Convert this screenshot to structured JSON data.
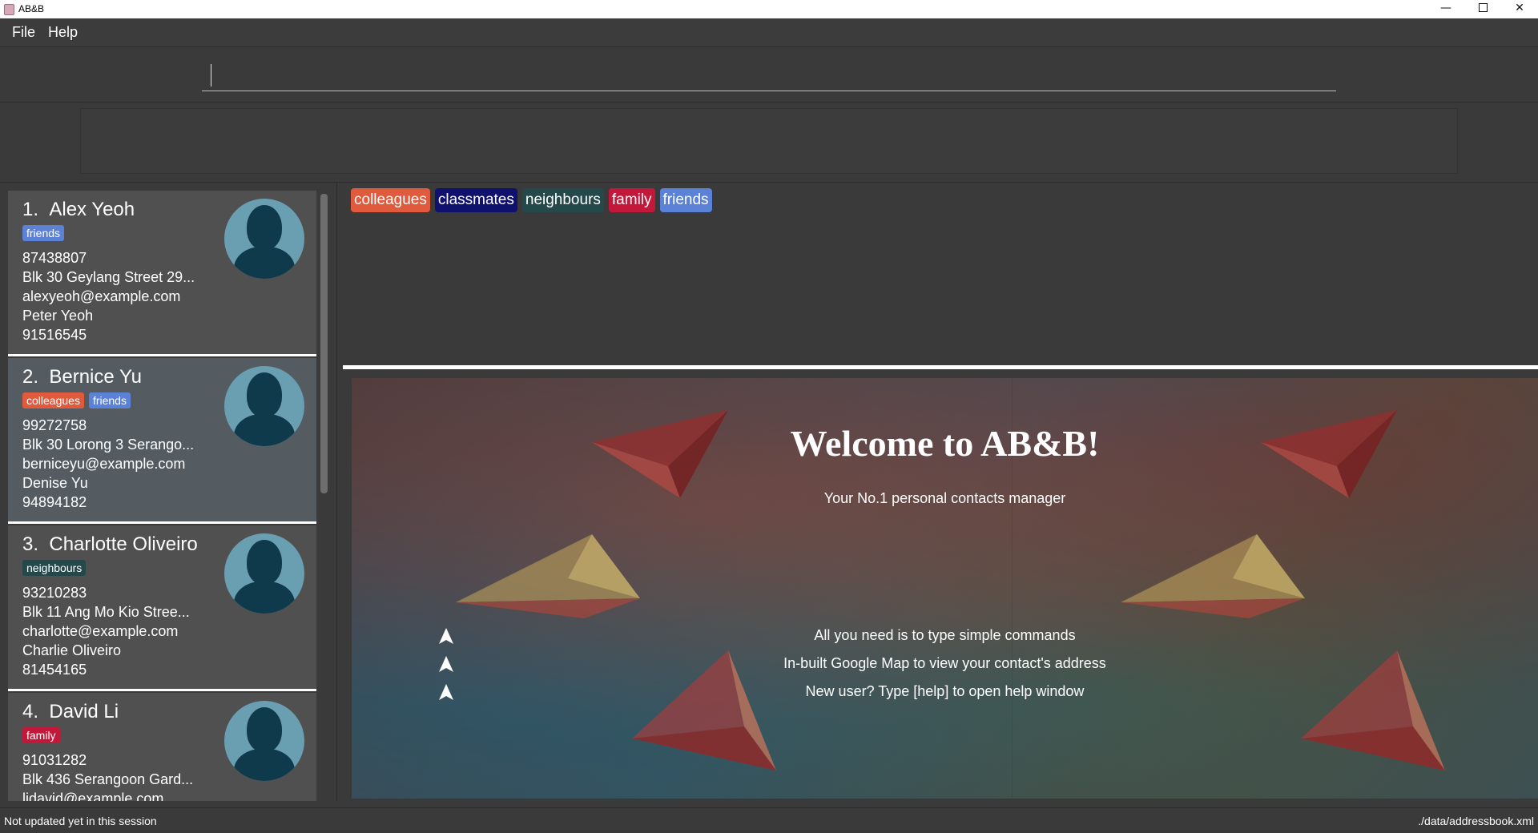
{
  "window": {
    "title": "AB&B",
    "min_glyph": "—",
    "close_glyph": "✕"
  },
  "menu": {
    "file": "File",
    "help": "Help"
  },
  "command": {
    "value": "",
    "placeholder": ""
  },
  "persons": [
    {
      "index": "1.",
      "name": "Alex Yeoh",
      "tags": [
        {
          "label": "friends",
          "color": "#5b82d6"
        }
      ],
      "phone": "87438807",
      "address": "Blk 30 Geylang Street 29...",
      "email": "alexyeoh@example.com",
      "contact_name": "Peter Yeoh",
      "contact_phone": "91516545"
    },
    {
      "index": "2.",
      "name": "Bernice Yu",
      "tags": [
        {
          "label": "colleagues",
          "color": "#e05a3d"
        },
        {
          "label": "friends",
          "color": "#5b82d6"
        }
      ],
      "phone": "99272758",
      "address": "Blk 30 Lorong 3 Serango...",
      "email": "berniceyu@example.com",
      "contact_name": "Denise Yu",
      "contact_phone": "94894182"
    },
    {
      "index": "3.",
      "name": "Charlotte Oliveiro",
      "tags": [
        {
          "label": "neighbours",
          "color": "#25484b"
        }
      ],
      "phone": "93210283",
      "address": "Blk 11 Ang Mo Kio Stree...",
      "email": "charlotte@example.com",
      "contact_name": "Charlie Oliveiro",
      "contact_phone": "81454165"
    },
    {
      "index": "4.",
      "name": "David Li",
      "tags": [
        {
          "label": "family",
          "color": "#c4183a"
        }
      ],
      "phone": "91031282",
      "address": "Blk 436 Serangoon Gard...",
      "email": "lidavid@example.com",
      "contact_name": "",
      "contact_phone": ""
    }
  ],
  "tag_bar": [
    {
      "label": "colleagues",
      "color": "#e05a3d"
    },
    {
      "label": "classmates",
      "color": "#10106e"
    },
    {
      "label": "neighbours",
      "color": "#25484b"
    },
    {
      "label": "family",
      "color": "#c4183a"
    },
    {
      "label": "friends",
      "color": "#5b82d6"
    }
  ],
  "browser": {
    "title": "Welcome to AB&B!",
    "subtitle": "Your No.1 personal contacts manager",
    "features": [
      "All you need is to type simple commands",
      "In-built Google Map to view your contact's address",
      "New user? Type [help] to open help window"
    ]
  },
  "status": {
    "sync": "Not updated yet in this session",
    "file_path": "./data/addressbook.xml"
  }
}
